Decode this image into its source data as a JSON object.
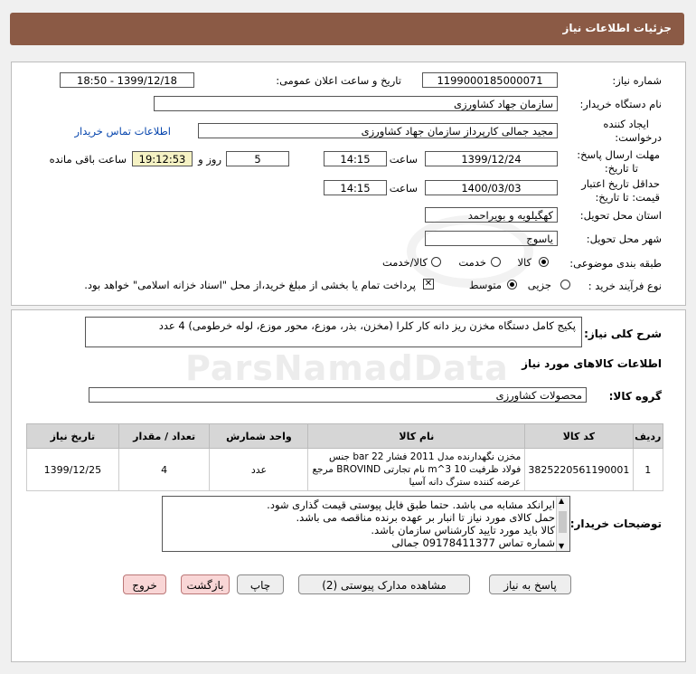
{
  "header": {
    "title": "جزئیات اطلاعات نیاز"
  },
  "form": {
    "need_number_label": "شماره نیاز:",
    "need_number": "1199000185000071",
    "announce_label": "تاریخ و ساعت اعلان عمومی:",
    "announce_value": "1399/12/18 - 18:50",
    "buyer_org_label": "نام دستگاه خریدار:",
    "buyer_org": "سازمان جهاد کشاورزی",
    "creator_label_1": "ایجاد کننده",
    "creator_label_2": "درخواست:",
    "creator": "مجید جمالی کارپرداز سازمان جهاد کشاورزی",
    "contact_link": "اطلاعات تماس خریدار",
    "reply_label_1": "مهلت ارسال پاسخ:",
    "reply_label_2": "تا تاریخ:",
    "reply_date": "1399/12/24",
    "time_label": "ساعت",
    "reply_time": "14:15",
    "days": "5",
    "day_label": "روز و",
    "remaining_time": "19:12:53",
    "remaining_label": "ساعت باقی مانده",
    "price_label_1": "حداقل تاریخ اعتبار",
    "price_label_2": "قیمت: تا تاریخ:",
    "price_date": "1400/03/03",
    "price_time": "14:15",
    "province_label": "استان محل تحویل:",
    "province": "کهگیلویه و بویراحمد",
    "city_label": "شهر محل تحویل:",
    "city": "یاسوج",
    "category_label": "طبقه بندی موضوعی:",
    "category_options": [
      "کالا",
      "خدمت",
      "کالا/خدمت"
    ],
    "process_label": "نوع فرآیند خرید :",
    "process_options": [
      "جزیی",
      "متوسط"
    ],
    "payment_note": "پرداخت تمام یا بخشی از مبلغ خرید،از محل \"اسناد خزانه اسلامی\" خواهد بود."
  },
  "description": {
    "label": "شرح کلی نیاز:",
    "text": "پکیج کامل دستگاه مخزن ریز دانه کار کلرا (مخزن، بذر، موزع، محور موزع، لوله خرطومی) 4 عدد"
  },
  "goods": {
    "section_title": "اطلاعات کالاهای مورد نیاز",
    "group_label": "گروه کالا:",
    "group_value": "محصولات کشاورزی",
    "columns": [
      "ردیف",
      "کد کالا",
      "نام کالا",
      "واحد شمارش",
      "تعداد / مقدار",
      "تاریخ نیاز"
    ],
    "rows": [
      {
        "index": "1",
        "code": "3825220561190001",
        "name": "مخزن نگهدارنده مدل 2011 فشار bar 22 جنس فولاد ظرفیت m^3 10 نام تجارتی BROVIND مرجع عرضه کننده سترگ دانه آسیا",
        "unit": "عدد",
        "qty": "4",
        "date": "1399/12/25"
      }
    ]
  },
  "buyer_notes": {
    "label": "توضیحات خریدار:",
    "lines": [
      "ایرانکد مشابه می باشد. حتما طبق فایل پیوستی قیمت گذاری شود.",
      "حمل کالای مورد نیاز تا انبار بر عهده برنده مناقصه می باشد.",
      "کالا باید مورد تایید کارشناس سازمان باشد.",
      "شماره تماس 09178411377 جمالی"
    ]
  },
  "buttons": {
    "reply": "پاسخ به نیاز",
    "attachments": "مشاهده مدارک پیوستی (2)",
    "print": "چاپ",
    "back": "بازگشت",
    "exit": "خروج"
  },
  "watermark": {
    "brand": "ParsNamadData"
  }
}
